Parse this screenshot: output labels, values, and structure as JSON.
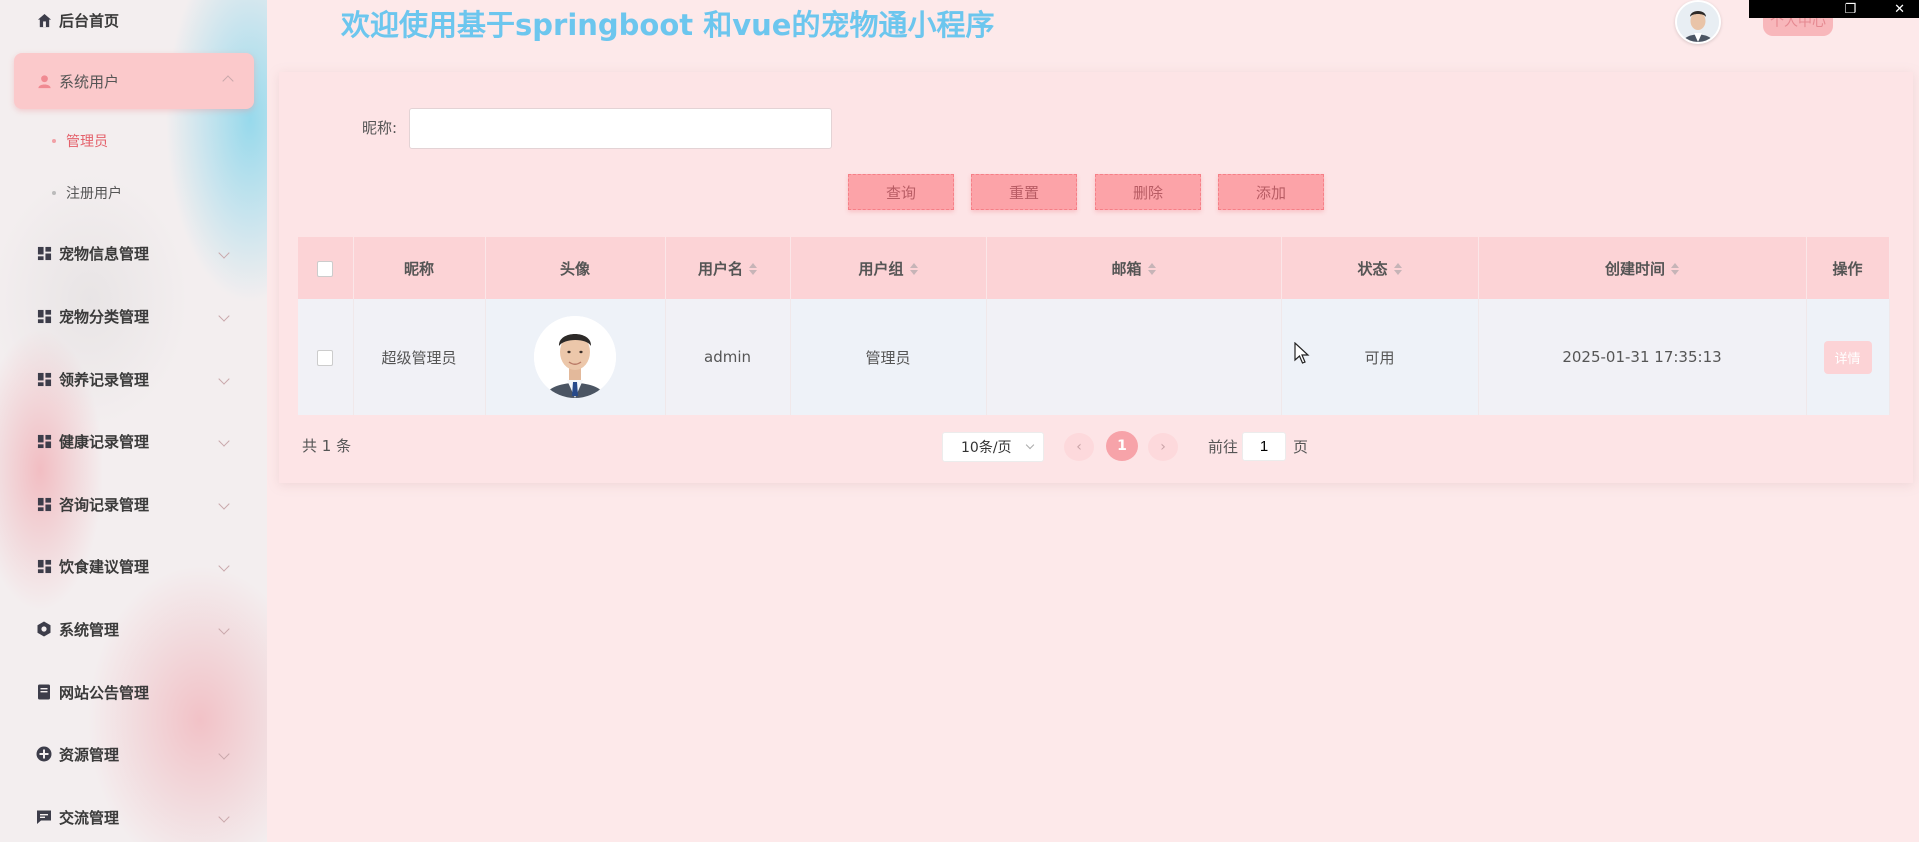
{
  "app": {
    "title": "欢迎使用基于springboot 和vue的宠物通小程序",
    "user_center_label": "个人中心"
  },
  "sidebar": {
    "items": [
      {
        "label": "后台首页",
        "icon": "home-icon"
      },
      {
        "label": "系统用户",
        "icon": "user-icon",
        "expanded": true,
        "children": [
          {
            "label": "管理员",
            "selected": true
          },
          {
            "label": "注册用户",
            "selected": false
          }
        ]
      },
      {
        "label": "宠物信息管理",
        "icon": "grid-icon"
      },
      {
        "label": "宠物分类管理",
        "icon": "grid-icon"
      },
      {
        "label": "领养记录管理",
        "icon": "grid-icon"
      },
      {
        "label": "健康记录管理",
        "icon": "grid-icon"
      },
      {
        "label": "咨询记录管理",
        "icon": "grid-icon"
      },
      {
        "label": "饮食建议管理",
        "icon": "grid-icon"
      },
      {
        "label": "系统管理",
        "icon": "gear-icon"
      },
      {
        "label": "网站公告管理",
        "icon": "document-icon"
      },
      {
        "label": "资源管理",
        "icon": "plus-circle-icon"
      },
      {
        "label": "交流管理",
        "icon": "chat-icon"
      }
    ]
  },
  "search": {
    "label": "昵称:",
    "value": "",
    "placeholder": ""
  },
  "actions": {
    "query": "查询",
    "reset": "重置",
    "delete": "删除",
    "add": "添加"
  },
  "table": {
    "columns": [
      "昵称",
      "头像",
      "用户名",
      "用户组",
      "邮箱",
      "状态",
      "创建时间",
      "操作"
    ],
    "rows": [
      {
        "nickname": "超级管理员",
        "username": "admin",
        "group": "管理员",
        "email": "",
        "status": "可用",
        "created": "2025-01-31 17:35:13",
        "action": "详情"
      }
    ]
  },
  "pagination": {
    "total": "共 1 条",
    "page_size": "10条/页",
    "current_page": "1",
    "goto_prefix": "前往",
    "goto_value": "1",
    "goto_suffix": "页"
  },
  "colors": {
    "accent": "#fca3a8",
    "title": "#6cc6ee",
    "selected_text": "#e4616b",
    "background": "#fde9ea"
  }
}
